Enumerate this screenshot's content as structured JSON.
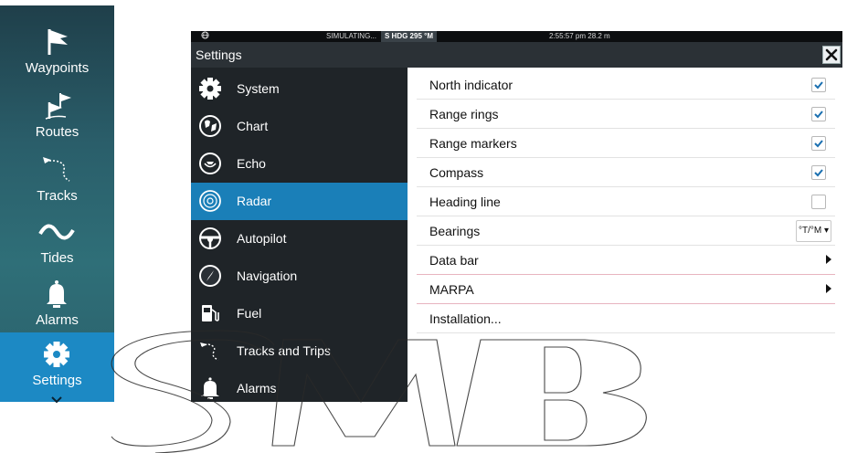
{
  "leftbar": {
    "items": [
      {
        "label": "Waypoints",
        "icon": "flag-icon"
      },
      {
        "label": "Routes",
        "icon": "route-flags-icon"
      },
      {
        "label": "Tracks",
        "icon": "track-icon"
      },
      {
        "label": "Tides",
        "icon": "wave-icon"
      },
      {
        "label": "Alarms",
        "icon": "bell-icon"
      },
      {
        "label": "Settings",
        "icon": "gear-icon"
      }
    ],
    "active": "Settings"
  },
  "status": {
    "mode": "SIMULATING...",
    "heading": "S HDG 295 °M",
    "time": "2:55:57 pm  28.2 m"
  },
  "dialog": {
    "title": "Settings",
    "close_symbol": "✕"
  },
  "menu": {
    "items": [
      {
        "label": "System",
        "icon": "gear-icon"
      },
      {
        "label": "Chart",
        "icon": "chart-icon"
      },
      {
        "label": "Echo",
        "icon": "echo-icon"
      },
      {
        "label": "Radar",
        "icon": "radar-icon"
      },
      {
        "label": "Autopilot",
        "icon": "steering-wheel-icon"
      },
      {
        "label": "Navigation",
        "icon": "compass-icon"
      },
      {
        "label": "Fuel",
        "icon": "fuel-pump-icon"
      },
      {
        "label": "Tracks and Trips",
        "icon": "track-icon"
      },
      {
        "label": "Alarms",
        "icon": "bell-icon"
      }
    ],
    "selected": "Radar"
  },
  "settings": {
    "rows": [
      {
        "label": "North indicator",
        "control": "checkbox",
        "checked": true
      },
      {
        "label": "Range rings",
        "control": "checkbox",
        "checked": true
      },
      {
        "label": "Range markers",
        "control": "checkbox",
        "checked": true
      },
      {
        "label": "Compass",
        "control": "checkbox",
        "checked": true
      },
      {
        "label": "Heading line",
        "control": "checkbox",
        "checked": false
      },
      {
        "label": "Bearings",
        "control": "dropdown",
        "value": "°T/°M"
      },
      {
        "label": "Data bar",
        "control": "submenu"
      },
      {
        "label": "MARPA",
        "control": "submenu"
      },
      {
        "label": "Installation...",
        "control": "none"
      }
    ]
  },
  "colors": {
    "accent": "#1a7fb8",
    "checkmark": "#1a6fb0",
    "panel": "#1f2428"
  }
}
